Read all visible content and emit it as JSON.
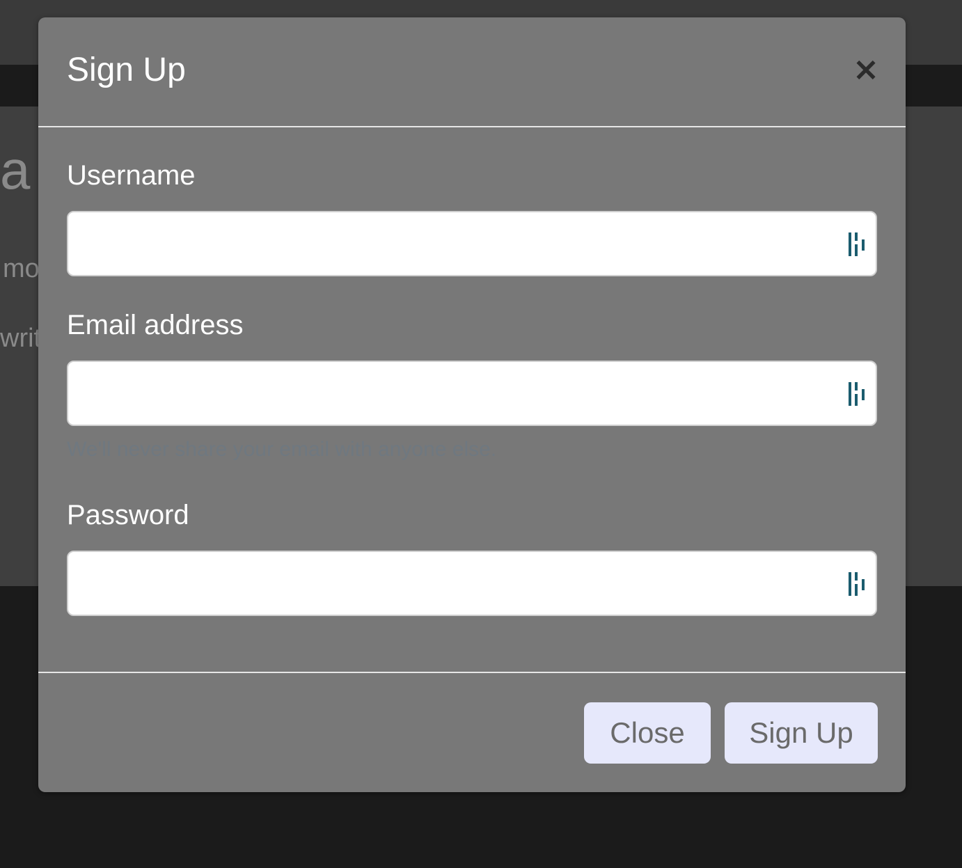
{
  "background": {
    "heading": "a",
    "lead": "mo",
    "text": "writ"
  },
  "modal": {
    "title": "Sign Up",
    "close_icon": "×",
    "fields": {
      "username": {
        "label": "Username",
        "value": "",
        "placeholder": ""
      },
      "email": {
        "label": "Email address",
        "value": "",
        "placeholder": "",
        "help": "We'll never share your email with anyone else."
      },
      "password": {
        "label": "Password",
        "value": "",
        "placeholder": ""
      }
    },
    "field_icon": "autofill-key-icon",
    "buttons": {
      "close": "Close",
      "signup": "Sign Up"
    }
  },
  "colors": {
    "modal_background": "#787878",
    "button_background": "#e6e8fb",
    "autofill_icon": "#1b5c6e"
  }
}
